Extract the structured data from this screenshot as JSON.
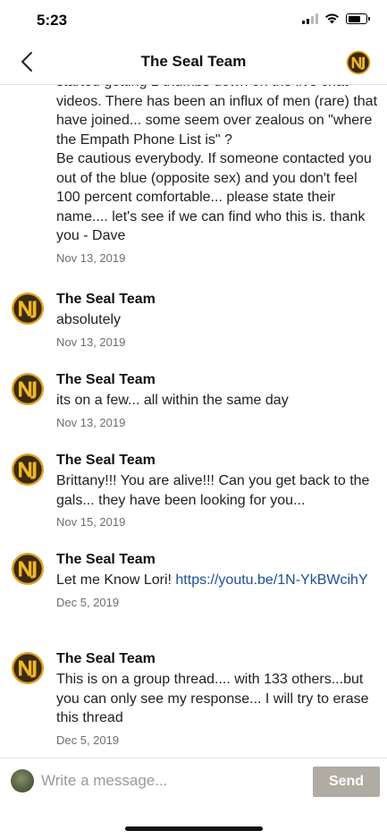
{
  "status_bar": {
    "time": "5:23"
  },
  "header": {
    "title": "The Seal Team",
    "avatar_icon": "seal-team-logo-icon"
  },
  "continuation": {
    "text": "started getting 1 thumbs down on the live chat videos. There has been an influx of men (rare) that have joined... some seem over zealous on \"where the Empath Phone List is\" ?\nBe cautious everybody.  If someone contacted you out of the blue (opposite sex) and you don't feel 100 percent comfortable... please state their name.... let's see if we can find who this is. thank you - Dave",
    "date": "Nov 13, 2019"
  },
  "messages": [
    {
      "sender": "The Seal Team",
      "text": "absolutely",
      "date": "Nov 13, 2019"
    },
    {
      "sender": "The Seal Team",
      "text": "its on a few... all within the same day",
      "date": "Nov 13, 2019"
    },
    {
      "sender": "The Seal Team",
      "text": "Brittany!!! You are alive!!! Can you get back to the gals... they have been looking for you...",
      "date": "Nov 15, 2019"
    },
    {
      "sender": "The Seal Team",
      "text": "Let me Know Lori! ",
      "link": "https://youtu.be/1N-YkBWcihY",
      "date": "Dec 5, 2019"
    },
    {
      "sender": "The Seal Team",
      "text": "This is on a group thread.... with 133 others...but you can only see my response... I will try to erase this thread",
      "date": "Dec 5, 2019"
    }
  ],
  "composer": {
    "placeholder": "Write a message...",
    "send_label": "Send"
  },
  "colors": {
    "link": "#1d4f9c",
    "send_button": "#b1aca3",
    "logo_gold": "#e0a21c"
  }
}
